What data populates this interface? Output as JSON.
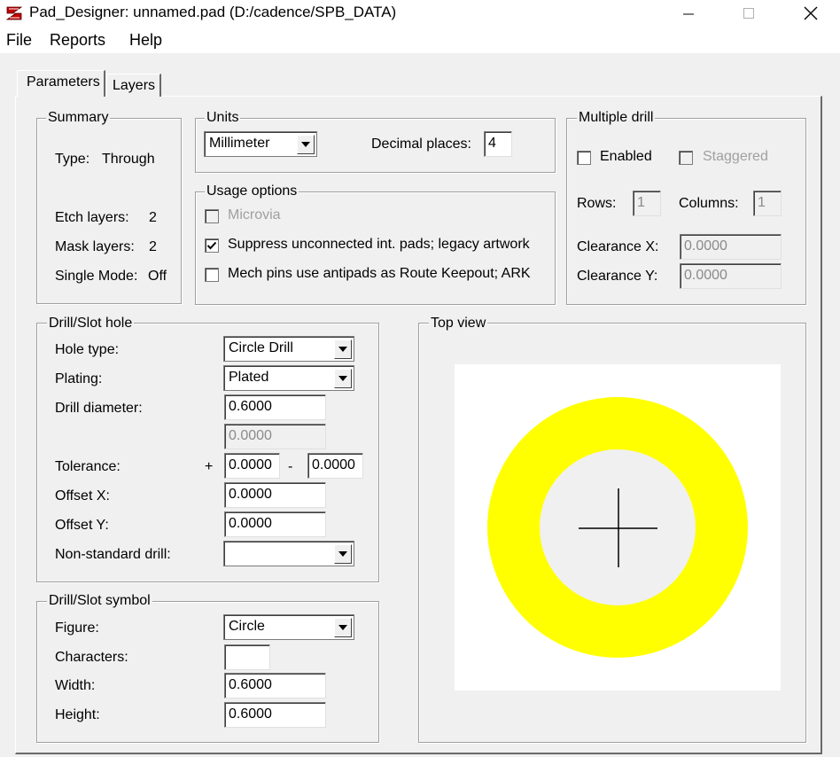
{
  "window": {
    "title": "Pad_Designer: unnamed.pad (D:/cadence/SPB_DATA)",
    "minimize": "—",
    "maximize": "☐",
    "close": "✕"
  },
  "menu": [
    "File",
    "Reports",
    "Help"
  ],
  "tabs": [
    "Parameters",
    "Layers"
  ],
  "summary": {
    "legend": "Summary",
    "type_label": "Type:",
    "type_value": "Through",
    "etch_label": "Etch layers:",
    "etch_value": "2",
    "mask_label": "Mask layers:",
    "mask_value": "2",
    "single_label": "Single Mode:",
    "single_value": "Off"
  },
  "units": {
    "legend": "Units",
    "selected": "Millimeter",
    "decimal_label": "Decimal places:",
    "decimal_value": "4"
  },
  "usage": {
    "legend": "Usage options",
    "microvia": "Microvia",
    "suppress": "Suppress unconnected int. pads; legacy artwork",
    "suppress_checked": true,
    "mech": "Mech pins use antipads as Route Keepout; ARK",
    "mech_checked": false
  },
  "multidrill": {
    "legend": "Multiple drill",
    "enabled": "Enabled",
    "staggered": "Staggered",
    "rows_label": "Rows:",
    "rows_value": "1",
    "cols_label": "Columns:",
    "cols_value": "1",
    "clrx_label": "Clearance X:",
    "clrx_value": "0.0000",
    "clry_label": "Clearance Y:",
    "clry_value": "0.0000"
  },
  "drill": {
    "legend": "Drill/Slot hole",
    "hole_type_label": "Hole type:",
    "hole_type_value": "Circle Drill",
    "plating_label": "Plating:",
    "plating_value": "Plated",
    "diameter_label": "Drill diameter:",
    "diameter_value": "0.6000",
    "diameter2_value": "0.0000",
    "tolerance_label": "Tolerance:",
    "tol_plus": "+",
    "tol_plus_value": "0.0000",
    "tol_minus": "-",
    "tol_minus_value": "0.0000",
    "offx_label": "Offset X:",
    "offx_value": "0.0000",
    "offy_label": "Offset Y:",
    "offy_value": "0.0000",
    "nonstd_label": "Non-standard drill:",
    "nonstd_value": ""
  },
  "symbol": {
    "legend": "Drill/Slot symbol",
    "figure_label": "Figure:",
    "figure_value": "Circle",
    "chars_label": "Characters:",
    "chars_value": "",
    "width_label": "Width:",
    "width_value": "0.6000",
    "height_label": "Height:",
    "height_value": "0.6000"
  },
  "topview": {
    "legend": "Top view",
    "pad_color": "#ffff00",
    "hole_color": "#f0f0f0",
    "bg_color": "#ffffff"
  }
}
